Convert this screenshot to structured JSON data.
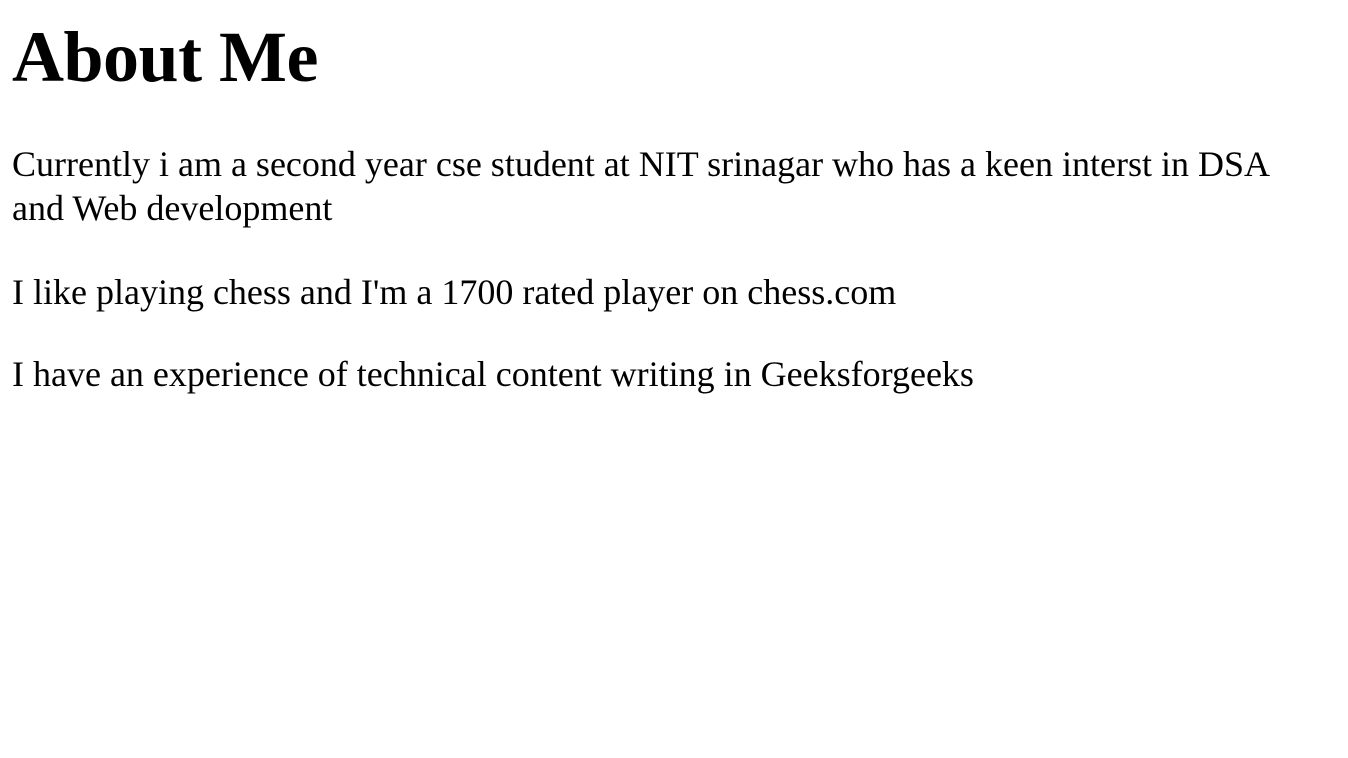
{
  "page": {
    "title": "About Me",
    "paragraphs": [
      "Currently i am a second year cse student at NIT srinagar who has a keen interst in DSA and Web development",
      "I like playing chess and I'm a 1700 rated player on chess.com",
      "I have an experience of technical content writing in Geeksforgeeks"
    ]
  }
}
